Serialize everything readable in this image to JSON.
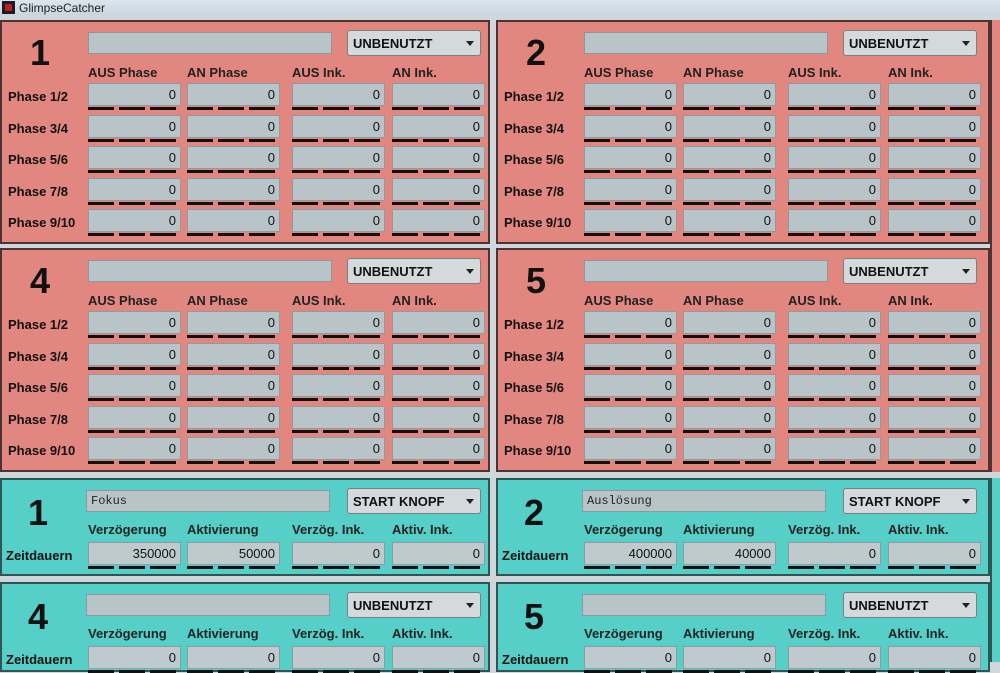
{
  "app": {
    "title": "GlimpseCatcher"
  },
  "phase_headers": [
    "AUS Phase",
    "AN Phase",
    "AUS Ink.",
    "AN Ink."
  ],
  "phase_rows": [
    "Phase 1/2",
    "Phase 3/4",
    "Phase 5/6",
    "Phase 7/8",
    "Phase 9/10"
  ],
  "timing_headers": [
    "Verzögerung",
    "Aktivierung",
    "Verzög. Ink.",
    "Aktiv. Ink."
  ],
  "timing_row_label": "Zeitdauern",
  "phase_panels": [
    {
      "number": "1",
      "name": "",
      "mode": "UNBENUTZT",
      "values": [
        [
          "0",
          "0",
          "0",
          "0"
        ],
        [
          "0",
          "0",
          "0",
          "0"
        ],
        [
          "0",
          "0",
          "0",
          "0"
        ],
        [
          "0",
          "0",
          "0",
          "0"
        ],
        [
          "0",
          "0",
          "0",
          "0"
        ]
      ]
    },
    {
      "number": "2",
      "name": "",
      "mode": "UNBENUTZT",
      "values": [
        [
          "0",
          "0",
          "0",
          "0"
        ],
        [
          "0",
          "0",
          "0",
          "0"
        ],
        [
          "0",
          "0",
          "0",
          "0"
        ],
        [
          "0",
          "0",
          "0",
          "0"
        ],
        [
          "0",
          "0",
          "0",
          "0"
        ]
      ]
    },
    {
      "number": "4",
      "name": "",
      "mode": "UNBENUTZT",
      "values": [
        [
          "0",
          "0",
          "0",
          "0"
        ],
        [
          "0",
          "0",
          "0",
          "0"
        ],
        [
          "0",
          "0",
          "0",
          "0"
        ],
        [
          "0",
          "0",
          "0",
          "0"
        ],
        [
          "0",
          "0",
          "0",
          "0"
        ]
      ]
    },
    {
      "number": "5",
      "name": "",
      "mode": "UNBENUTZT",
      "values": [
        [
          "0",
          "0",
          "0",
          "0"
        ],
        [
          "0",
          "0",
          "0",
          "0"
        ],
        [
          "0",
          "0",
          "0",
          "0"
        ],
        [
          "0",
          "0",
          "0",
          "0"
        ],
        [
          "0",
          "0",
          "0",
          "0"
        ]
      ]
    }
  ],
  "timing_panels": [
    {
      "number": "1",
      "name": "Fokus",
      "mode": "START KNOPF",
      "values": [
        "350000",
        "50000",
        "0",
        "0"
      ]
    },
    {
      "number": "2",
      "name": "Auslösung",
      "mode": "START KNOPF",
      "values": [
        "400000",
        "40000",
        "0",
        "0"
      ]
    },
    {
      "number": "4",
      "name": "",
      "mode": "UNBENUTZT",
      "values": [
        "0",
        "0",
        "0",
        "0"
      ]
    },
    {
      "number": "5",
      "name": "",
      "mode": "UNBENUTZT",
      "values": [
        "0",
        "0",
        "0",
        "0"
      ]
    }
  ]
}
